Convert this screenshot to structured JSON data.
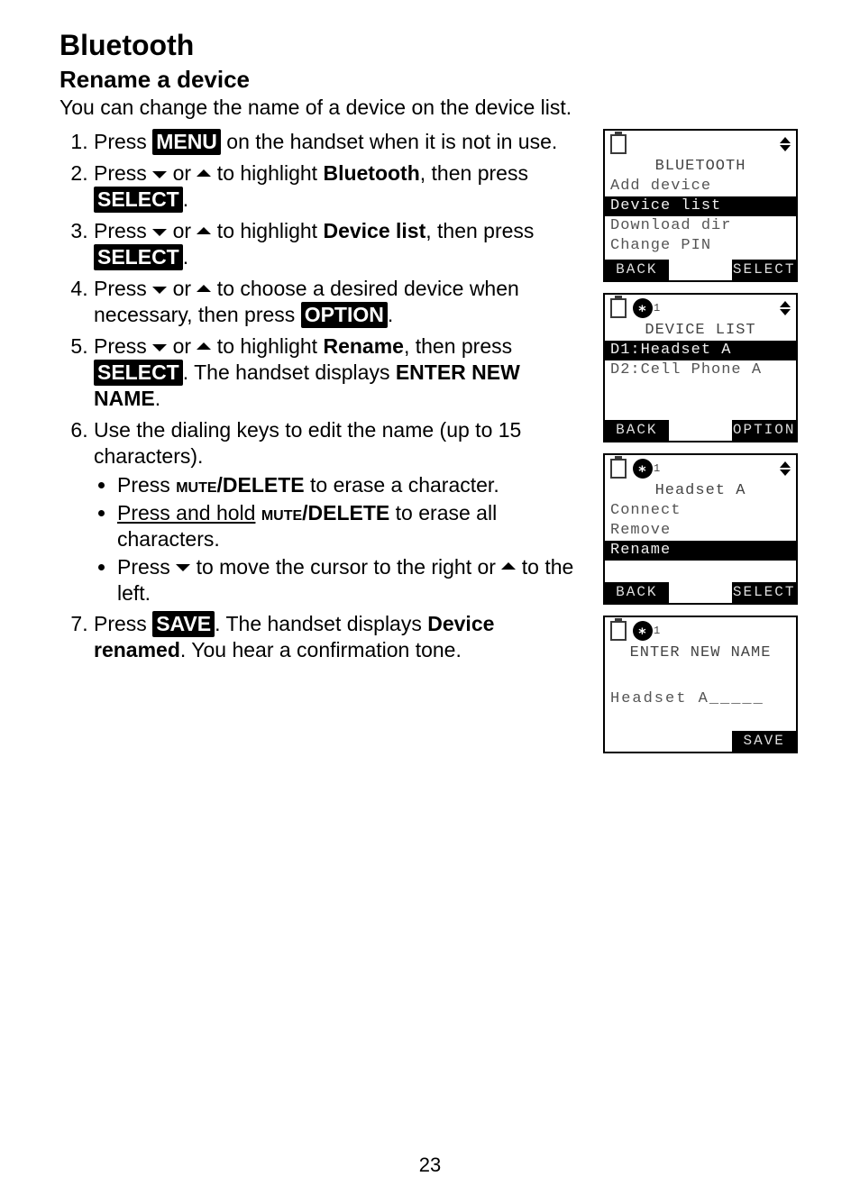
{
  "page": {
    "number": "23",
    "title": "Bluetooth",
    "subtitle": "Rename a device",
    "intro": "You can change the name of a device on the device list."
  },
  "steps": {
    "s1_a": "Press ",
    "s1_key": "MENU",
    "s1_b": " on the handset when it is not in use.",
    "s2_a": "Press ",
    "s2_b": " or ",
    "s2_c": " to highlight ",
    "s2_bold": "Bluetooth",
    "s2_d": ", then press ",
    "s2_key": "SELECT",
    "s2_e": ".",
    "s3_a": "Press ",
    "s3_b": " or ",
    "s3_c": " to highlight ",
    "s3_bold": "Device list",
    "s3_d": ", then press ",
    "s3_key": "SELECT",
    "s3_e": ".",
    "s4_a": "Press ",
    "s4_b": " or ",
    "s4_c": " to choose a desired device when necessary, then press ",
    "s4_key": "OPTION",
    "s4_d": ".",
    "s5_a": "Press ",
    "s5_b": " or ",
    "s5_c": " to highlight ",
    "s5_bold": "Rename",
    "s5_d": ", then press ",
    "s5_key": "SELECT",
    "s5_e": ". The handset displays ",
    "s5_bold2": "ENTER NEW NAME",
    "s5_f": ".",
    "s6_a": "Use the dialing keys to edit the name (up to 15 characters).",
    "s6_b1_a": "Press ",
    "s6_b1_mute": "mute",
    "s6_b1_del": "/DELETE",
    "s6_b1_b": " to erase a character.",
    "s6_b2_a": "Press and hold",
    "s6_b2_mute": "mute",
    "s6_b2_del": "/DELETE",
    "s6_b2_b": " to erase all characters.",
    "s6_b3_a": "Press ",
    "s6_b3_b": " to move the cursor to the right or ",
    "s6_b3_c": " to the left.",
    "s7_a": "Press ",
    "s7_key": "SAVE",
    "s7_b": ". The handset displays ",
    "s7_bold": "Device renamed",
    "s7_c": ". You hear a confirmation tone."
  },
  "lcd1": {
    "title": "BLUETOOTH",
    "l1": "Add device",
    "l2": "Device list",
    "l3": "Download dir",
    "l4": "Change PIN",
    "back": "BACK",
    "select": "SELECT"
  },
  "lcd2": {
    "bt_sub": "1",
    "title": "DEVICE LIST",
    "l1": "D1:Headset A",
    "l2": "D2:Cell Phone A",
    "back": "BACK",
    "option": "OPTION"
  },
  "lcd3": {
    "bt_sub": "1",
    "title": "Headset A",
    "l1": "Connect",
    "l2": "Remove",
    "l3": "Rename",
    "back": "BACK",
    "select": "SELECT"
  },
  "lcd4": {
    "bt_sub": "1",
    "title": "ENTER NEW NAME",
    "input": "Headset A_____",
    "save": "SAVE"
  }
}
